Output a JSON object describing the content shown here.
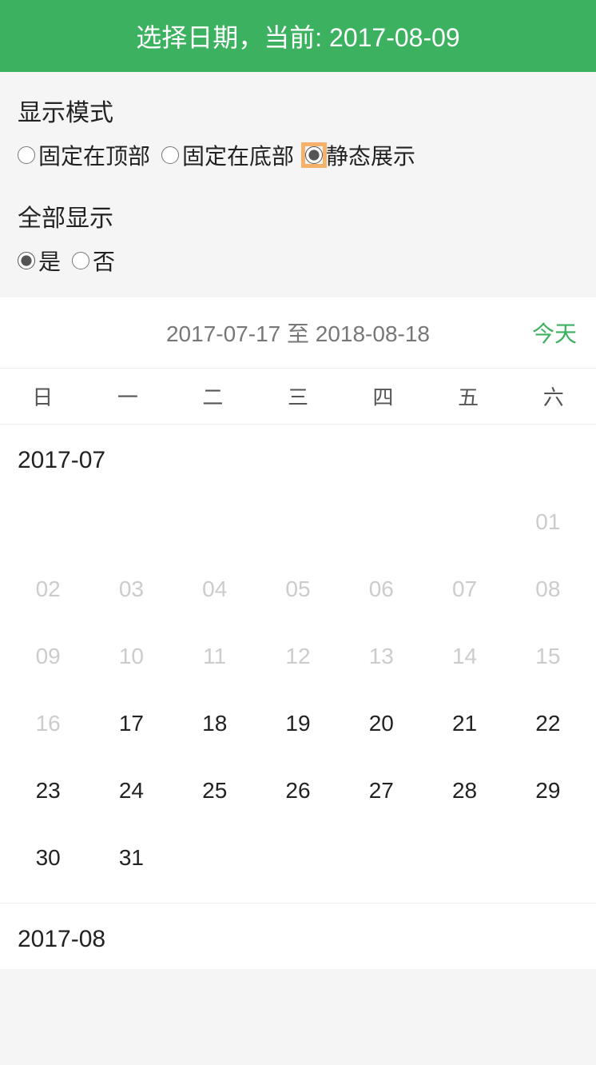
{
  "header": {
    "title": "选择日期，当前: 2017-08-09"
  },
  "settings": {
    "display_mode": {
      "title": "显示模式",
      "options": [
        {
          "label": "固定在顶部",
          "checked": false,
          "highlighted": false
        },
        {
          "label": "固定在底部",
          "checked": false,
          "highlighted": false
        },
        {
          "label": "静态展示",
          "checked": true,
          "highlighted": true
        }
      ]
    },
    "show_all": {
      "title": "全部显示",
      "options": [
        {
          "label": "是",
          "checked": true
        },
        {
          "label": "否",
          "checked": false
        }
      ]
    }
  },
  "calendar": {
    "range_text": "2017-07-17 至 2018-08-18",
    "today_label": "今天",
    "weekdays": [
      "日",
      "一",
      "二",
      "三",
      "四",
      "五",
      "六"
    ],
    "months": [
      {
        "label": "2017-07",
        "leading_blanks": 6,
        "days": [
          {
            "text": "01",
            "disabled": true
          },
          {
            "text": "02",
            "disabled": true
          },
          {
            "text": "03",
            "disabled": true
          },
          {
            "text": "04",
            "disabled": true
          },
          {
            "text": "05",
            "disabled": true
          },
          {
            "text": "06",
            "disabled": true
          },
          {
            "text": "07",
            "disabled": true
          },
          {
            "text": "08",
            "disabled": true
          },
          {
            "text": "09",
            "disabled": true
          },
          {
            "text": "10",
            "disabled": true
          },
          {
            "text": "11",
            "disabled": true
          },
          {
            "text": "12",
            "disabled": true
          },
          {
            "text": "13",
            "disabled": true
          },
          {
            "text": "14",
            "disabled": true
          },
          {
            "text": "15",
            "disabled": true
          },
          {
            "text": "16",
            "disabled": true
          },
          {
            "text": "17",
            "disabled": false
          },
          {
            "text": "18",
            "disabled": false
          },
          {
            "text": "19",
            "disabled": false
          },
          {
            "text": "20",
            "disabled": false
          },
          {
            "text": "21",
            "disabled": false
          },
          {
            "text": "22",
            "disabled": false
          },
          {
            "text": "23",
            "disabled": false
          },
          {
            "text": "24",
            "disabled": false
          },
          {
            "text": "25",
            "disabled": false
          },
          {
            "text": "26",
            "disabled": false
          },
          {
            "text": "27",
            "disabled": false
          },
          {
            "text": "28",
            "disabled": false
          },
          {
            "text": "29",
            "disabled": false
          },
          {
            "text": "30",
            "disabled": false
          },
          {
            "text": "31",
            "disabled": false
          }
        ]
      },
      {
        "label": "2017-08",
        "leading_blanks": 2,
        "days": []
      }
    ]
  }
}
